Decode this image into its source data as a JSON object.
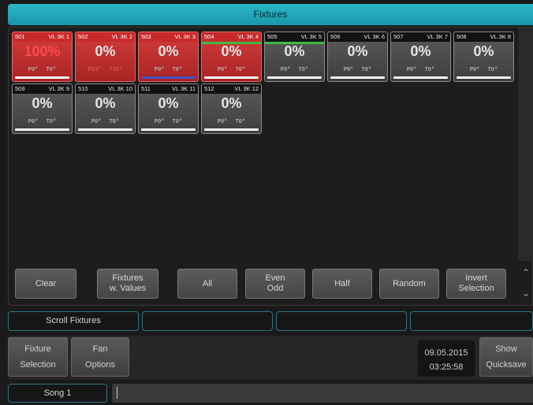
{
  "window": {
    "title": "Fixtures"
  },
  "fixtures": [
    {
      "num": "501",
      "name": "VL 3K 1",
      "pct": "100%",
      "pt": "P0° T0°",
      "selected": true,
      "hot": true,
      "pt_hot": false,
      "bar": "white",
      "topline": false
    },
    {
      "num": "502",
      "name": "VL 3K 2",
      "pct": "0%",
      "pt": "P33° T35°",
      "selected": true,
      "hot": false,
      "pt_hot": true,
      "bar": "none",
      "topline": false
    },
    {
      "num": "503",
      "name": "VL 3K 3",
      "pct": "0%",
      "pt": "P0° T0°",
      "selected": true,
      "hot": false,
      "pt_hot": false,
      "bar": "blue",
      "topline": false
    },
    {
      "num": "504",
      "name": "VL 3K 4",
      "pct": "0%",
      "pt": "P0° T0°",
      "selected": true,
      "hot": false,
      "pt_hot": false,
      "bar": "white",
      "topline": true
    },
    {
      "num": "505",
      "name": "VL 3K 5",
      "pct": "0%",
      "pt": "P0° T0°",
      "selected": false,
      "hot": false,
      "pt_hot": false,
      "bar": "white",
      "topline": true
    },
    {
      "num": "506",
      "name": "VL 3K 6",
      "pct": "0%",
      "pt": "P0° T0°",
      "selected": false,
      "hot": false,
      "pt_hot": false,
      "bar": "white",
      "topline": false
    },
    {
      "num": "507",
      "name": "VL 3K 7",
      "pct": "0%",
      "pt": "P0° T0°",
      "selected": false,
      "hot": false,
      "pt_hot": false,
      "bar": "white",
      "topline": false
    },
    {
      "num": "508",
      "name": "VL 3K 8",
      "pct": "0%",
      "pt": "P0° T0°",
      "selected": false,
      "hot": false,
      "pt_hot": false,
      "bar": "white",
      "topline": false
    },
    {
      "num": "509",
      "name": "VL 3K 9",
      "pct": "0%",
      "pt": "P0° T0°",
      "selected": false,
      "hot": false,
      "pt_hot": false,
      "bar": "white",
      "topline": false
    },
    {
      "num": "510",
      "name": "VL 3K 10",
      "pct": "0%",
      "pt": "P0° T0°",
      "selected": false,
      "hot": false,
      "pt_hot": false,
      "bar": "white",
      "topline": false
    },
    {
      "num": "511",
      "name": "VL 3K 11",
      "pct": "0%",
      "pt": "P0° T0°",
      "selected": false,
      "hot": false,
      "pt_hot": false,
      "bar": "white",
      "topline": false
    },
    {
      "num": "512",
      "name": "VL 3K 12",
      "pct": "0%",
      "pt": "P0° T0°",
      "selected": false,
      "hot": false,
      "pt_hot": false,
      "bar": "white",
      "topline": false
    }
  ],
  "selection_buttons": {
    "clear": "Clear",
    "fixtures_values_1": "Fixtures",
    "fixtures_values_2": "w. Values",
    "all": "All",
    "even_odd_1": "Even",
    "even_odd_2": "Odd",
    "half": "Half",
    "random": "Random",
    "invert_1": "Invert",
    "invert_2": "Selection"
  },
  "icons": {
    "scroll_up": "chevron-up-icon",
    "scroll_down": "chevron-down-icon"
  },
  "command_row": {
    "scroll_fixtures": "Scroll Fixtures"
  },
  "bottom": {
    "fixture_selection_1": "Fixture",
    "fixture_selection_2": "Selection",
    "fan_options_1": "Fan",
    "fan_options_2": "Options",
    "date": "09.05.2015",
    "time": "03:25:58",
    "show_quicksave_1": "Show",
    "show_quicksave_2": "Quicksave"
  },
  "status": {
    "song": "Song 1"
  },
  "colors": {
    "accent": "#1fa7b8",
    "selected": "#c83030",
    "highlight_green": "#3fbb44",
    "bar_blue": "#3d56c8"
  }
}
